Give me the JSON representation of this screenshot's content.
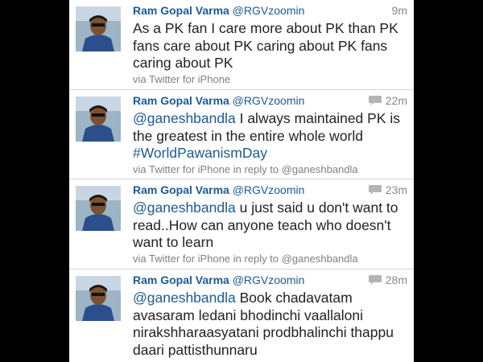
{
  "colors": {
    "link": "#1c5a94",
    "meta": "#888888",
    "text": "#222222",
    "backdrop": "#000000"
  },
  "tweets": [
    {
      "name": "Ram Gopal Varma",
      "handle": "@RGVzoomin",
      "time": "9m",
      "has_reply_icon": false,
      "text": "As a PK fan I care more about PK than PK fans care about PK caring about PK fans caring about PK",
      "source": "via Twitter for iPhone"
    },
    {
      "name": "Ram Gopal Varma",
      "handle": "@RGVzoomin",
      "time": "22m",
      "has_reply_icon": true,
      "mention": "@ganeshbandla",
      "text": " I always maintained PK is the greatest in the entire whole world ",
      "hashtag": "#WorldPawanismDay",
      "source": "via Twitter for iPhone in reply to @ganeshbandla"
    },
    {
      "name": "Ram Gopal Varma",
      "handle": "@RGVzoomin",
      "time": "23m",
      "has_reply_icon": true,
      "mention": "@ganeshbandla",
      "text": " u just said u don't want to read..How can anyone teach who doesn't want to learn",
      "source": "via Twitter for iPhone in reply to @ganeshbandla"
    },
    {
      "name": "Ram Gopal Varma",
      "handle": "@RGVzoomin",
      "time": "28m",
      "has_reply_icon": true,
      "mention": "@ganeshbandla",
      "text": " Book chadavatam avasaram ledani bhodinchi vaallaloni nirakshharaasyatani prodbhalinchi thappu daari pattisthunnaru"
    }
  ],
  "icons": {
    "reply": "speech-bubble-icon",
    "avatar": "profile-photo"
  }
}
